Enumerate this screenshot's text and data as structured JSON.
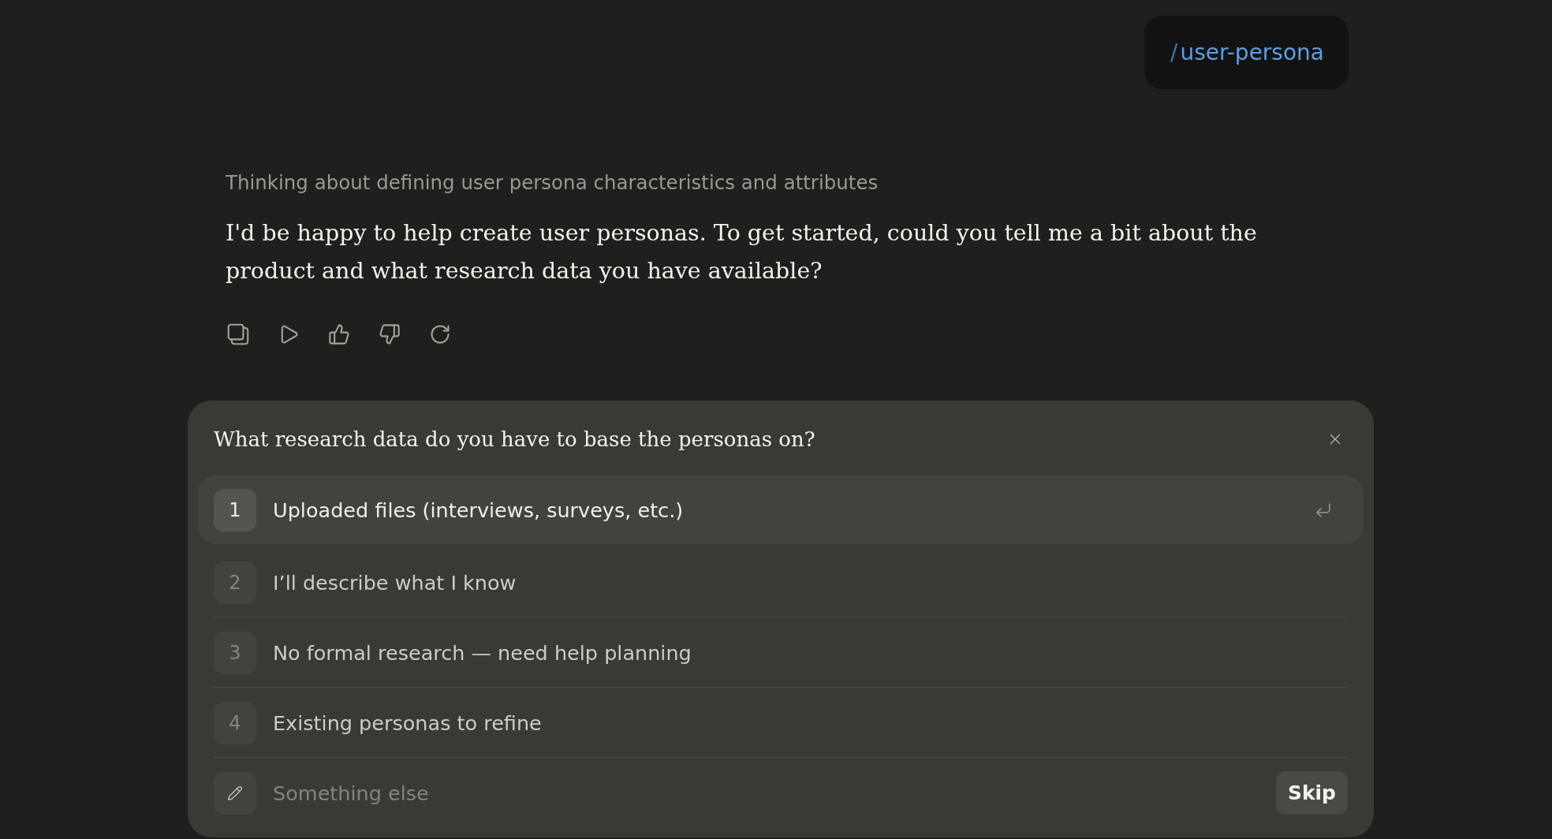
{
  "user_message": {
    "prefix": "/",
    "command": "user-persona"
  },
  "assistant": {
    "thinking": "Thinking about defining user persona characteristics and attributes",
    "message": "I'd be happy to help create user personas. To get started, could you tell me a bit about the product and what research data you have available?"
  },
  "question_card": {
    "question": "What research data do you have to base the personas on?",
    "options": [
      {
        "number": "1",
        "label": "Uploaded files (interviews, surveys, etc.)",
        "selected": true
      },
      {
        "number": "2",
        "label": "I’ll describe what I know",
        "selected": false
      },
      {
        "number": "3",
        "label": "No formal research — need help planning",
        "selected": false
      },
      {
        "number": "4",
        "label": "Existing personas to refine",
        "selected": false
      }
    ],
    "custom_answer": {
      "placeholder": "Something else"
    },
    "skip_button": "Skip"
  }
}
